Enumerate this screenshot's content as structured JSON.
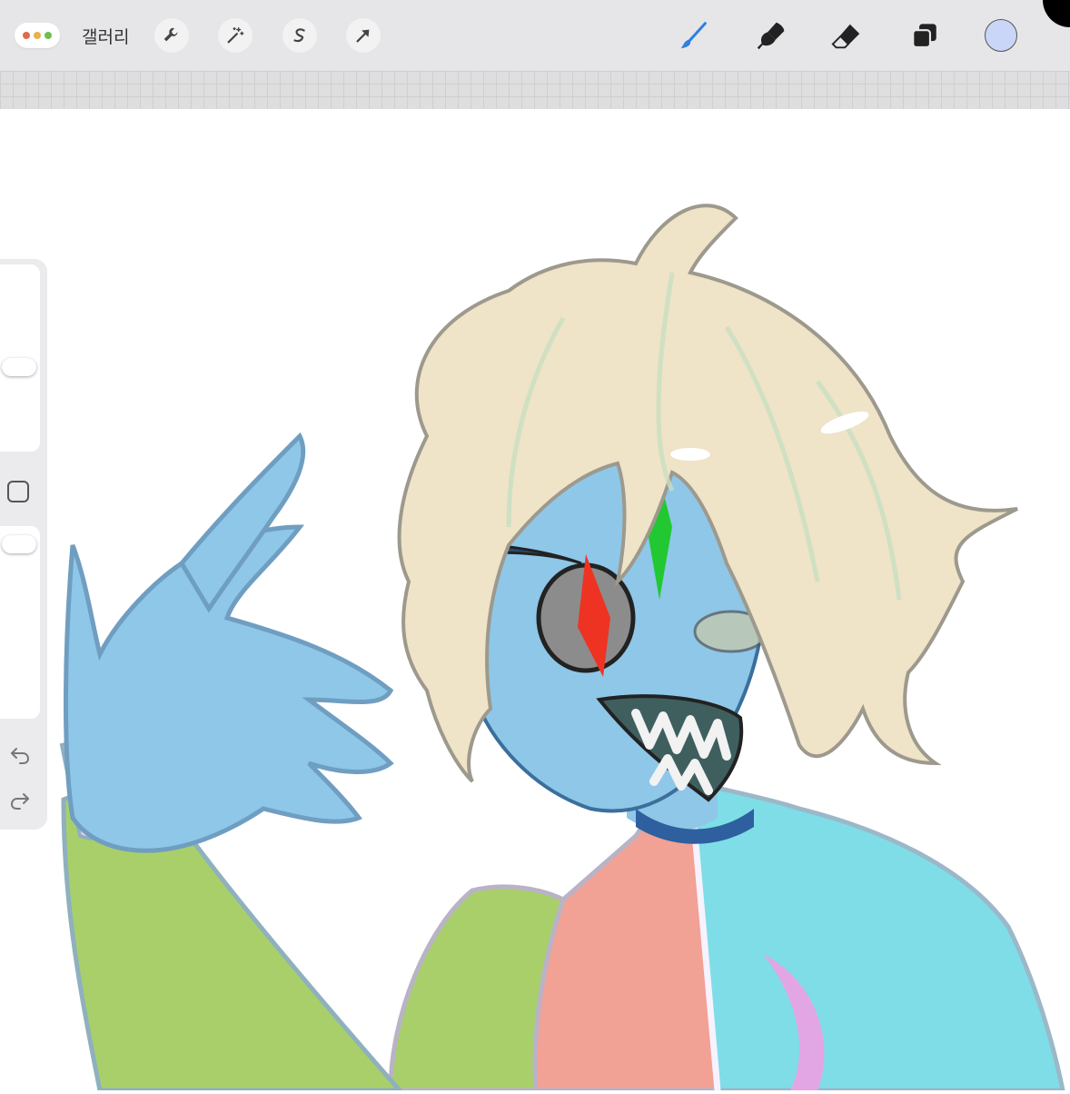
{
  "toolbar": {
    "gallery_label": "갤러리",
    "window_dots": [
      "#e06a4b",
      "#e8b14a",
      "#6fbf4e"
    ],
    "left_tools": [
      "wrench-icon",
      "magic-wand-icon",
      "selection-icon",
      "move-arrow-icon"
    ],
    "right_tools": [
      "brush-icon",
      "smudge-icon",
      "eraser-icon",
      "layers-icon"
    ],
    "active_tool_color": "#2f7fe0",
    "current_color": "#c9d6f7"
  },
  "sidebar": {
    "controls": [
      "brush-size-slider",
      "modify-square-button",
      "opacity-slider",
      "undo-icon",
      "redo-icon"
    ]
  },
  "canvas": {
    "background": "#ffffff",
    "colors": {
      "hair": "#efe3c8",
      "skin": "#8ec7e8",
      "jacket_left": "#a9cf6b",
      "jacket_mid": "#f2a195",
      "jacket_right": "#7fdde7",
      "cuff": "#f2c9f2",
      "gem_green": "#22c832",
      "gem_red": "#ee3322"
    }
  }
}
